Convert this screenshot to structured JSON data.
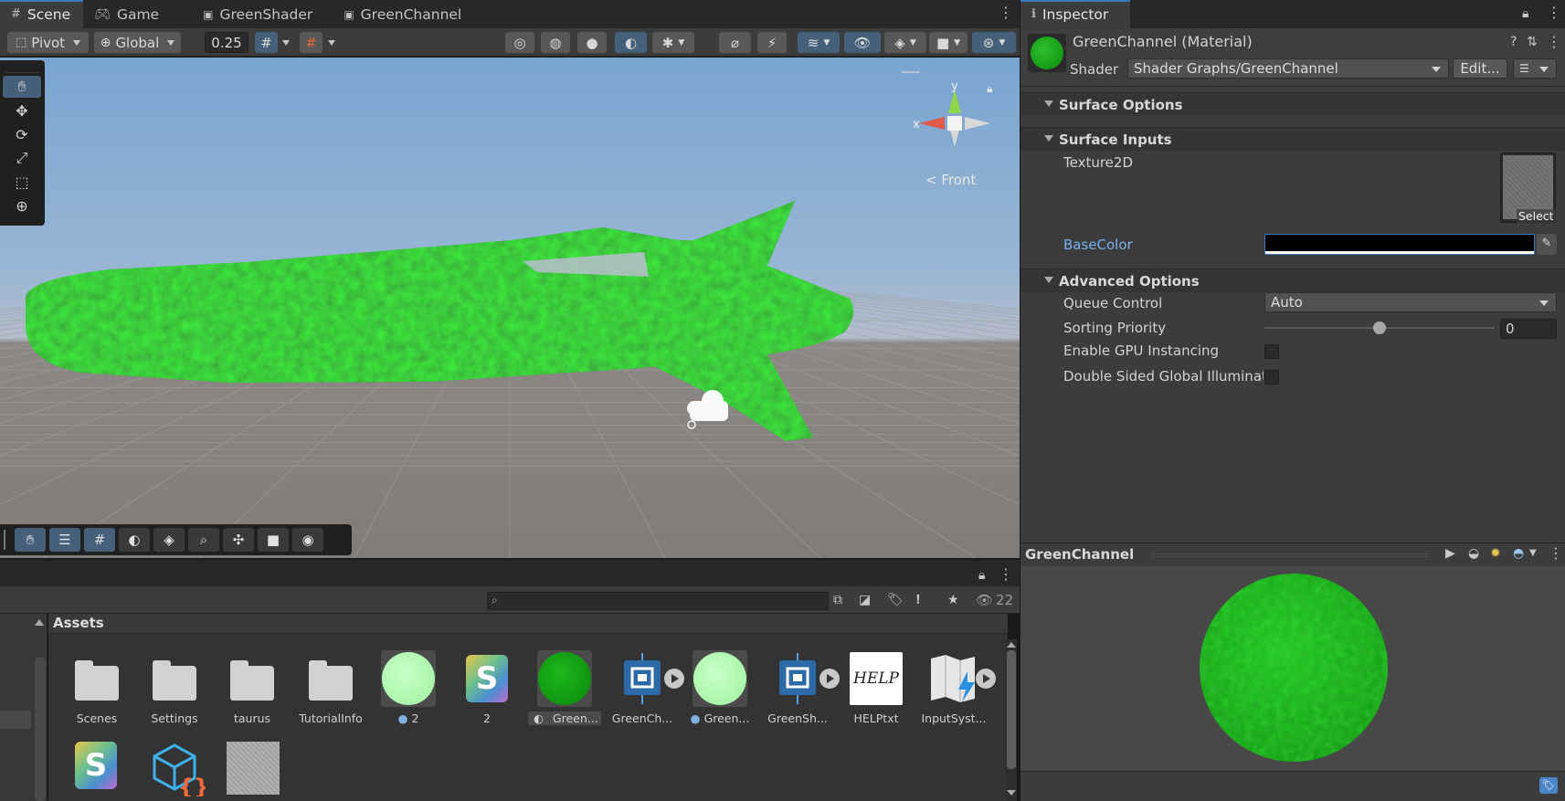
{
  "scene_tabs": [
    {
      "label": "Scene",
      "icon": "scene-grid-icon",
      "active": true
    },
    {
      "label": "Game",
      "icon": "gamepad-icon",
      "active": false
    },
    {
      "label": "GreenShader",
      "icon": "shadergraph-icon",
      "active": false
    },
    {
      "label": "GreenChannel",
      "icon": "shadergraph-icon",
      "active": false
    }
  ],
  "toolbar": {
    "pivot_label": "Pivot",
    "global_label": "Global",
    "snap_value": "0.25"
  },
  "gizmo": {
    "y_label": "y",
    "x_label": "x",
    "view_label": "Front"
  },
  "project": {
    "hidden_count": "22",
    "assets_title": "Assets",
    "assets": [
      {
        "label": "Scenes",
        "kind": "folder"
      },
      {
        "label": "Settings",
        "kind": "folder"
      },
      {
        "label": "taurus",
        "kind": "folder"
      },
      {
        "label": "TutorialInfo",
        "kind": "folder"
      },
      {
        "label": "2",
        "kind": "material-light"
      },
      {
        "label": "2",
        "kind": "shader"
      },
      {
        "label": "Green...",
        "kind": "material-green",
        "selected": true
      },
      {
        "label": "GreenCh...",
        "kind": "shadergraph"
      },
      {
        "label": "Green...",
        "kind": "material-light"
      },
      {
        "label": "GreenSh...",
        "kind": "shadergraph"
      },
      {
        "label": "HELPtxt",
        "kind": "text"
      },
      {
        "label": "InputSyst...",
        "kind": "inputactions"
      }
    ]
  },
  "inspector": {
    "tab_label": "Inspector",
    "material_name": "GreenChannel (Material)",
    "shader_label": "Shader",
    "shader_value": "Shader Graphs/GreenChannel",
    "edit_label": "Edit...",
    "sections": {
      "surface_options": "Surface Options",
      "surface_inputs": "Surface Inputs",
      "advanced_options": "Advanced Options"
    },
    "texture_label": "Texture2D",
    "texture_select": "Select",
    "basecolor_label": "BaseColor",
    "queue_label": "Queue Control",
    "queue_value": "Auto",
    "sorting_label": "Sorting Priority",
    "sorting_value": "0",
    "sorting_level": 0.5,
    "gpu_label": "Enable GPU Instancing",
    "gpu_checked": false,
    "dsgi_label": "Double Sided Global Illuminatio",
    "dsgi_checked": false
  },
  "preview": {
    "title": "GreenChannel"
  },
  "colors": {
    "accent": "#3a79bb",
    "active_tool": "#46607c",
    "grass_green": "#1aa61a",
    "panel_bg": "#3c3c3c"
  }
}
